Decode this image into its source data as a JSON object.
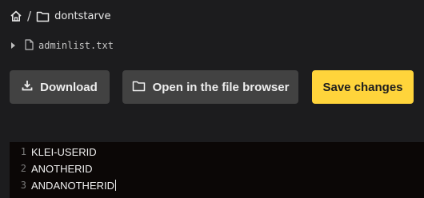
{
  "breadcrumb": {
    "home_icon": "home-icon",
    "separator": "/",
    "folder_icon": "folder-icon",
    "folder_name": "dontstarve"
  },
  "file": {
    "caret_icon": "caret-right-icon",
    "file_icon": "file-icon",
    "name": "adminlist.txt"
  },
  "toolbar": {
    "download_label": "Download",
    "download_icon": "download-icon",
    "browser_label": "Open in the file browser",
    "browser_icon": "folder-icon",
    "save_label": "Save changes"
  },
  "colors": {
    "background": "#1c1c1e",
    "button_dark": "#424242",
    "button_accent": "#ffd43b",
    "editor_bg": "#0b0706"
  },
  "editor": {
    "lines": [
      {
        "number": "1",
        "text": "KLEI-USERID"
      },
      {
        "number": "2",
        "text": "ANOTHERID"
      },
      {
        "number": "3",
        "text": "ANDANOTHERID"
      }
    ]
  }
}
